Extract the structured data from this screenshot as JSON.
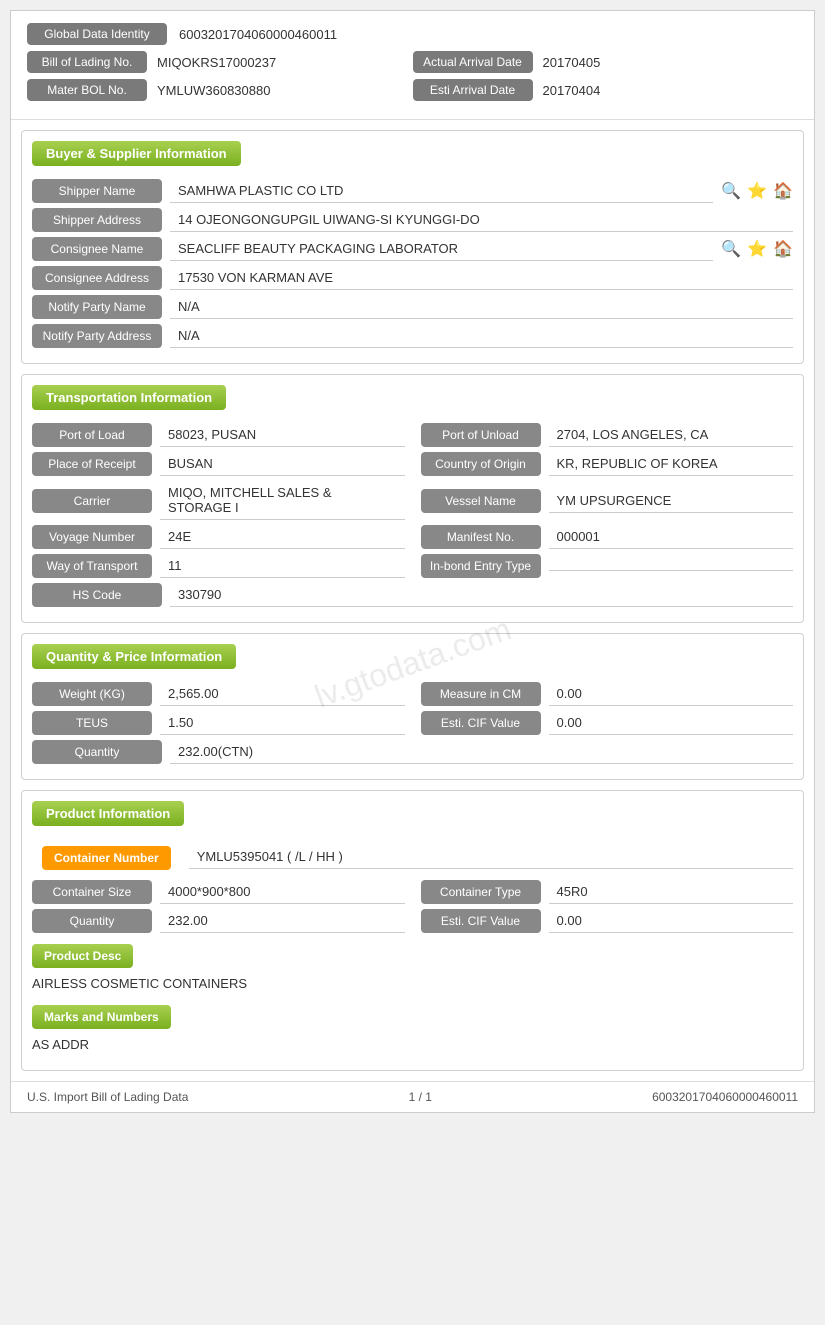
{
  "watermark": "lv.gtodata.com",
  "identity": {
    "global_data_label": "Global Data Identity",
    "global_data_value": "600320170406000046001​1",
    "bill_lading_label": "Bill of Lading No.",
    "bill_lading_value": "MIQOKRS17000237",
    "actual_arrival_label": "Actual Arrival Date",
    "actual_arrival_value": "20170405",
    "mater_bol_label": "Mater BOL No.",
    "mater_bol_value": "YMLUW360830880",
    "esti_arrival_label": "Esti Arrival Date",
    "esti_arrival_value": "20170404"
  },
  "buyer_supplier": {
    "section_title": "Buyer & Supplier Information",
    "shipper_name_label": "Shipper Name",
    "shipper_name_value": "SAMHWA PLASTIC CO LTD",
    "shipper_address_label": "Shipper Address",
    "shipper_address_value": "14 OJEONGONGUPGIL UIWANG-SI KYUNGGI-DO",
    "consignee_name_label": "Consignee Name",
    "consignee_name_value": "SEACLIFF BEAUTY PACKAGING LABORATOR",
    "consignee_address_label": "Consignee Address",
    "consignee_address_value": "17530 VON KARMAN AVE",
    "notify_party_name_label": "Notify Party Name",
    "notify_party_name_value": "N/A",
    "notify_party_address_label": "Notify Party Address",
    "notify_party_address_value": "N/A"
  },
  "transportation": {
    "section_title": "Transportation Information",
    "port_load_label": "Port of Load",
    "port_load_value": "58023, PUSAN",
    "port_unload_label": "Port of Unload",
    "port_unload_value": "2704, LOS ANGELES, CA",
    "place_receipt_label": "Place of Receipt",
    "place_receipt_value": "BUSAN",
    "country_origin_label": "Country of Origin",
    "country_origin_value": "KR, REPUBLIC OF KOREA",
    "carrier_label": "Carrier",
    "carrier_value": "MIQO, MITCHELL SALES & STORAGE I",
    "vessel_name_label": "Vessel Name",
    "vessel_name_value": "YM UPSURGENCE",
    "voyage_number_label": "Voyage Number",
    "voyage_number_value": "24E",
    "manifest_no_label": "Manifest No.",
    "manifest_no_value": "000001",
    "way_transport_label": "Way of Transport",
    "way_transport_value": "11",
    "in_bond_label": "In-bond Entry Type",
    "in_bond_value": "",
    "hs_code_label": "HS Code",
    "hs_code_value": "330790"
  },
  "quantity_price": {
    "section_title": "Quantity & Price Information",
    "weight_label": "Weight (KG)",
    "weight_value": "2,565.00",
    "measure_label": "Measure in CM",
    "measure_value": "0.00",
    "teus_label": "TEUS",
    "teus_value": "1.50",
    "esti_cif_label": "Esti. CIF Value",
    "esti_cif_value": "0.00",
    "quantity_label": "Quantity",
    "quantity_value": "232.00(CTN)"
  },
  "product_info": {
    "section_title": "Product Information",
    "container_number_badge": "Container Number",
    "container_number_value": "YMLU5395041 ( /L / HH )",
    "container_size_label": "Container Size",
    "container_size_value": "4000*900*800",
    "container_type_label": "Container Type",
    "container_type_value": "45R0",
    "quantity_label": "Quantity",
    "quantity_value": "232.00",
    "esti_cif_label": "Esti. CIF Value",
    "esti_cif_value": "0.00",
    "product_desc_badge": "Product Desc",
    "product_desc_text": "AIRLESS COSMETIC CONTAINERS",
    "marks_numbers_badge": "Marks and Numbers",
    "marks_numbers_text": "AS ADDR"
  },
  "footer": {
    "left": "U.S. Import Bill of Lading Data",
    "center": "1 / 1",
    "right": "600320170406000046001​1"
  },
  "icons": {
    "search": "🔍",
    "star": "⭐",
    "home": "🏠"
  }
}
